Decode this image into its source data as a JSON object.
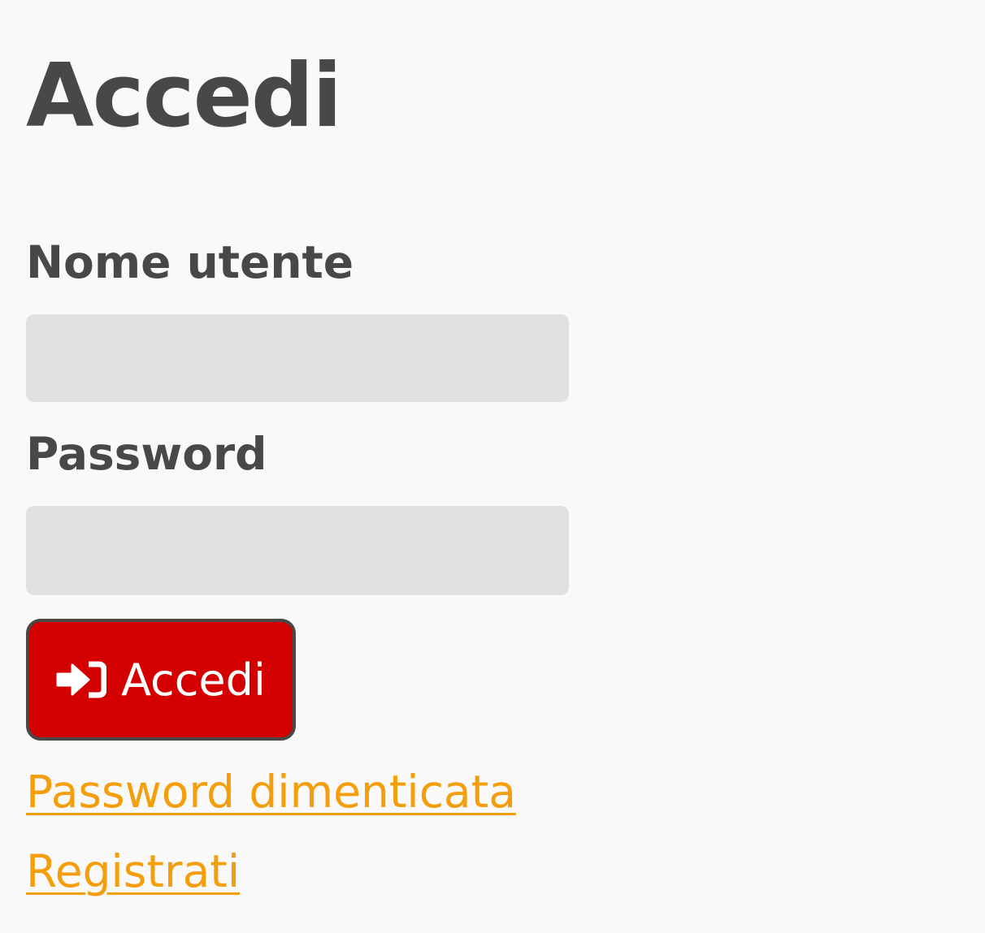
{
  "page": {
    "title": "Accedi"
  },
  "form": {
    "username_label": "Nome utente",
    "username_value": "",
    "password_label": "Password",
    "password_value": "",
    "submit_label": "Accedi",
    "submit_icon": "sign-in-icon"
  },
  "links": {
    "forgot_password": "Password dimenticata",
    "register": "Registrati"
  },
  "colors": {
    "background": "#f9f9f9",
    "text": "#484848",
    "field_background": "#e1e1e1",
    "button_background": "#d40000",
    "button_border": "#484848",
    "link": "#f59e0b"
  }
}
